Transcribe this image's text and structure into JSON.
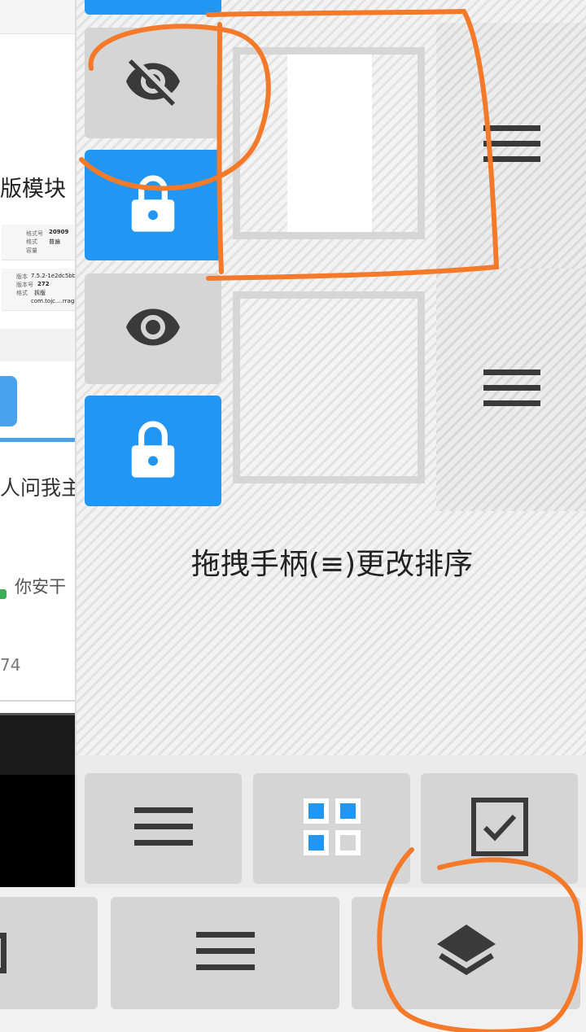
{
  "background_app": {
    "title_partial": "版模块",
    "meta_lines_1": [
      "格式号",
      "20909",
      "格式",
      "普遍",
      "容量"
    ],
    "meta_lines_2": [
      "版本",
      "7.5.2-1e2dc5bb",
      "版本号",
      "272",
      "格式",
      "拆版",
      "com.tojc....rragh"
    ],
    "ask_partial": "人问我主",
    "reply_partial": "你安干",
    "count_partial": "74"
  },
  "layers_panel": {
    "hint_text": "拖拽手柄(≡)更改排序",
    "layers": [
      {
        "visible": false,
        "locked": true,
        "has_content": true
      },
      {
        "visible": true,
        "locked": true,
        "has_content": false
      }
    ],
    "toolbar": [
      {
        "name": "list-view",
        "icon": "menu-icon"
      },
      {
        "name": "grid-view",
        "icon": "grid-icon"
      },
      {
        "name": "select",
        "icon": "checkbox-icon"
      }
    ]
  },
  "bottom_toolbar": [
    {
      "name": "partial-left",
      "icon": "partial-icon"
    },
    {
      "name": "menu",
      "icon": "menu-icon"
    },
    {
      "name": "layers",
      "icon": "layers-icon"
    }
  ],
  "colors": {
    "accent_blue": "#2196f3",
    "button_gray": "#d5d5d5",
    "icon_dark": "#3a3a3a",
    "annotation_orange": "#f47a2a"
  }
}
